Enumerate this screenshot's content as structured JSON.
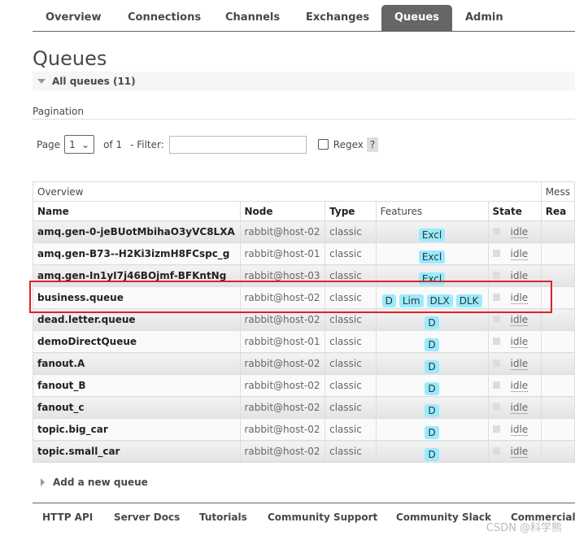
{
  "nav": {
    "tabs": [
      "Overview",
      "Connections",
      "Channels",
      "Exchanges",
      "Queues",
      "Admin"
    ],
    "active": "Queues"
  },
  "page_title": "Queues",
  "section_title": "All queues (11)",
  "pagination": {
    "label": "Pagination",
    "page_label": "Page",
    "page_value": "1",
    "of_label": "of 1",
    "filter_label": "- Filter:",
    "filter_value": "",
    "regex_label": "Regex",
    "regex_checked": false,
    "help": "?"
  },
  "table": {
    "group_headers": [
      "Overview",
      "Mess"
    ],
    "columns": [
      "Name",
      "Node",
      "Type",
      "Features",
      "State",
      "Rea"
    ],
    "rows": [
      {
        "name": "amq.gen-0-jeBUotMbihaO3yVC8LXA",
        "node": "rabbit@host-02",
        "type": "classic",
        "features": [
          "Excl"
        ],
        "state": "idle"
      },
      {
        "name": "amq.gen-B73--H2Ki3izmH8FCspc_g",
        "node": "rabbit@host-01",
        "type": "classic",
        "features": [
          "Excl"
        ],
        "state": "idle"
      },
      {
        "name": "amq.gen-In1yI7j46BOjmf-BFKntNg",
        "node": "rabbit@host-03",
        "type": "classic",
        "features": [
          "Excl"
        ],
        "state": "idle"
      },
      {
        "name": "business.queue",
        "node": "rabbit@host-02",
        "type": "classic",
        "features": [
          "D",
          "Lim",
          "DLX",
          "DLK"
        ],
        "state": "idle",
        "highlighted": true
      },
      {
        "name": "dead.letter.queue",
        "node": "rabbit@host-02",
        "type": "classic",
        "features": [
          "D"
        ],
        "state": "idle"
      },
      {
        "name": "demoDirectQueue",
        "node": "rabbit@host-01",
        "type": "classic",
        "features": [
          "D"
        ],
        "state": "idle"
      },
      {
        "name": "fanout.A",
        "node": "rabbit@host-02",
        "type": "classic",
        "features": [
          "D"
        ],
        "state": "idle"
      },
      {
        "name": "fanout_B",
        "node": "rabbit@host-02",
        "type": "classic",
        "features": [
          "D"
        ],
        "state": "idle"
      },
      {
        "name": "fanout_c",
        "node": "rabbit@host-02",
        "type": "classic",
        "features": [
          "D"
        ],
        "state": "idle"
      },
      {
        "name": "topic.big_car",
        "node": "rabbit@host-02",
        "type": "classic",
        "features": [
          "D"
        ],
        "state": "idle"
      },
      {
        "name": "topic.small_car",
        "node": "rabbit@host-02",
        "type": "classic",
        "features": [
          "D"
        ],
        "state": "idle"
      }
    ]
  },
  "add_queue": "Add a new queue",
  "footer": [
    "HTTP API",
    "Server Docs",
    "Tutorials",
    "Community Support",
    "Community Slack",
    "Commercial"
  ],
  "watermark": "CSDN @科学熊",
  "colors": {
    "badge": "#99ebff",
    "active_tab": "#666666",
    "highlight": "#e0202a"
  }
}
